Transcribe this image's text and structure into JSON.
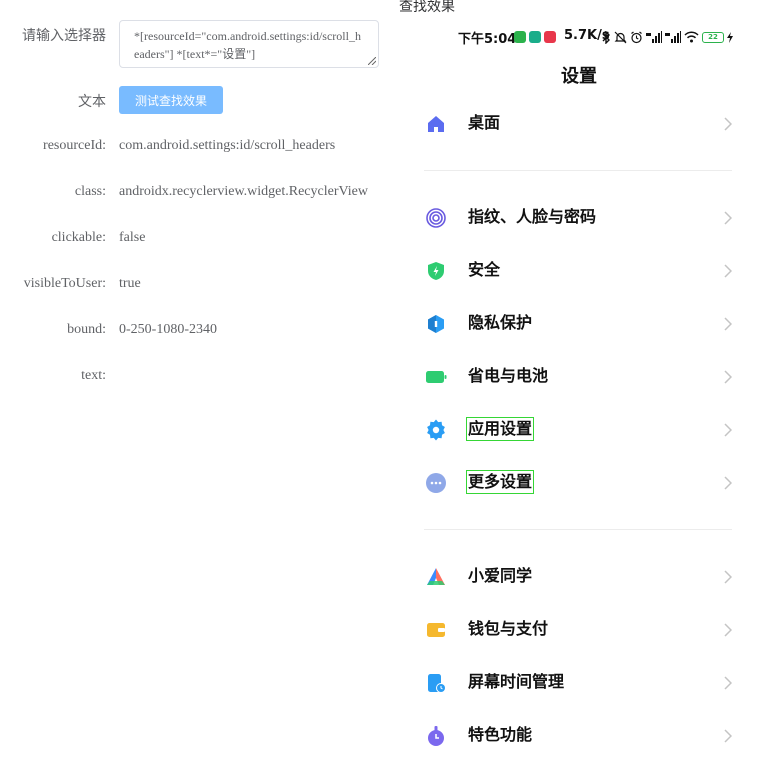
{
  "form": {
    "selector_label": "请输入选择器",
    "selector_value": "*[resourceId=\"com.android.settings:id/scroll_headers\"] *[text*=\"设置\"]",
    "text_label": "文本",
    "test_button": "测试查找效果"
  },
  "info": [
    {
      "key": "resourceId:",
      "value": "com.android.settings:id/scroll_headers"
    },
    {
      "key": "class:",
      "value": "androidx.recyclerview.widget.RecyclerView"
    },
    {
      "key": "clickable:",
      "value": "false"
    },
    {
      "key": "visibleToUser:",
      "value": "true"
    },
    {
      "key": "bound:",
      "value": "0-250-1080-2340"
    },
    {
      "key": "text:",
      "value": ""
    }
  ],
  "preview": {
    "header": "查找效果",
    "status": {
      "time": "下午5:04",
      "speed": "5.7K/s",
      "battery": "22"
    },
    "title": "设置",
    "items": [
      {
        "label": "桌面",
        "icon": "home-icon",
        "color": "#5b6cf0"
      },
      {
        "label": "指纹、人脸与密码",
        "icon": "fingerprint-icon",
        "color": "#6a5be0"
      },
      {
        "label": "安全",
        "icon": "shield-icon",
        "color": "#2ecc71"
      },
      {
        "label": "隐私保护",
        "icon": "privacy-icon",
        "color": "#2a9df4"
      },
      {
        "label": "省电与电池",
        "icon": "battery-icon",
        "color": "#2ecc71"
      },
      {
        "label": "应用设置",
        "icon": "gear-icon",
        "color": "#2a9df4",
        "highlighted": true
      },
      {
        "label": "更多设置",
        "icon": "more-icon",
        "color": "#8fa8e8",
        "highlighted": true
      },
      {
        "label": "小爱同学",
        "icon": "xiaoai-icon",
        "color": "#ff6f61"
      },
      {
        "label": "钱包与支付",
        "icon": "wallet-icon",
        "color": "#f5b82e"
      },
      {
        "label": "屏幕时间管理",
        "icon": "screen-time-icon",
        "color": "#2a9df4"
      },
      {
        "label": "特色功能",
        "icon": "features-icon",
        "color": "#7b68ee"
      }
    ]
  }
}
